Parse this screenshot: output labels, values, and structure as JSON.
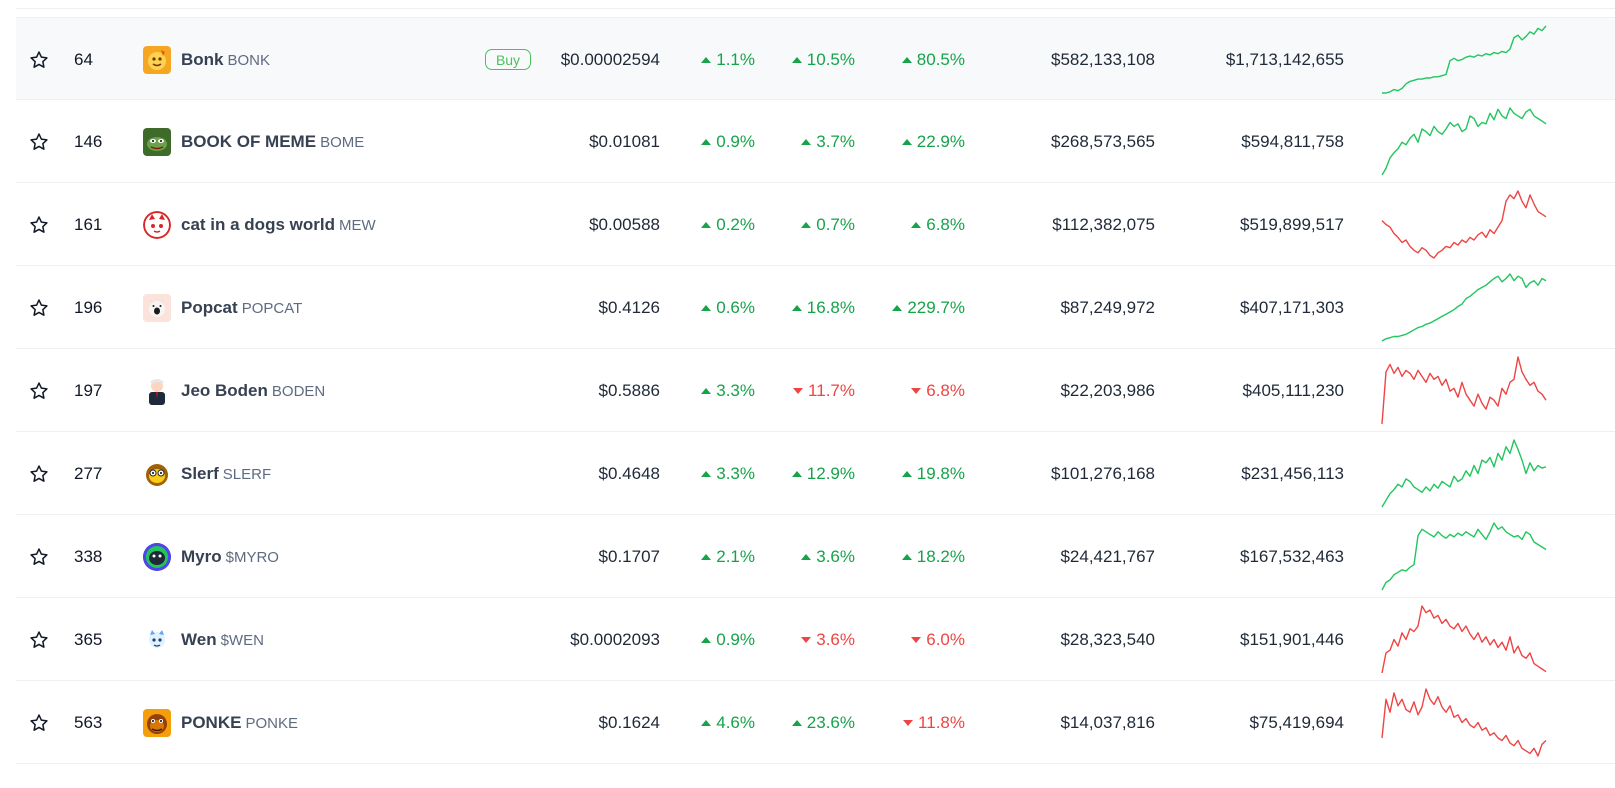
{
  "actions": {
    "buy_label": "Buy"
  },
  "colors": {
    "up": "#16a34a",
    "down": "#ef4444",
    "spark_up": "#22c55e",
    "spark_down": "#ef4444"
  },
  "rows": [
    {
      "rank": "64",
      "name": "Bonk",
      "symbol": "BONK",
      "logo": "bonk-logo",
      "price": "$0.00002594",
      "c1h": "1.1%",
      "c1h_dir": "up",
      "c24h": "10.5%",
      "c24h_dir": "up",
      "c7d": "80.5%",
      "c7d_dir": "up",
      "volume": "$582,133,108",
      "mcap": "$1,713,142,655",
      "trend": "up",
      "spark": [
        2,
        2,
        3,
        5,
        4,
        6,
        10,
        12,
        13,
        14,
        14,
        15,
        15,
        16,
        16,
        17,
        18,
        30,
        32,
        30,
        31,
        33,
        34,
        33,
        35,
        34,
        36,
        35,
        37,
        36,
        38,
        37,
        40,
        50,
        52,
        48,
        51,
        55,
        53,
        58,
        56,
        60
      ]
    },
    {
      "rank": "146",
      "name": "BOOK OF MEME",
      "symbol": "BOME",
      "logo": "bome-logo",
      "price": "$0.01081",
      "c1h": "0.9%",
      "c1h_dir": "up",
      "c24h": "3.7%",
      "c24h_dir": "up",
      "c7d": "22.9%",
      "c7d_dir": "up",
      "volume": "$268,573,565",
      "mcap": "$594,811,758",
      "trend": "up",
      "spark": [
        5,
        10,
        18,
        22,
        25,
        30,
        28,
        33,
        36,
        30,
        40,
        38,
        35,
        42,
        38,
        36,
        40,
        45,
        42,
        44,
        38,
        40,
        50,
        48,
        42,
        45,
        44,
        52,
        47,
        55,
        50,
        48,
        56,
        52,
        50,
        48,
        53,
        55,
        50,
        48,
        46,
        44
      ]
    },
    {
      "rank": "161",
      "name": "cat in a dogs world",
      "symbol": "MEW",
      "logo": "mew-logo",
      "price": "$0.00588",
      "c1h": "0.2%",
      "c1h_dir": "up",
      "c24h": "0.7%",
      "c24h_dir": "up",
      "c7d": "6.8%",
      "c7d_dir": "up",
      "volume": "$112,382,075",
      "mcap": "$519,899,517",
      "trend": "down",
      "spark": [
        35,
        32,
        30,
        25,
        22,
        18,
        20,
        15,
        12,
        10,
        14,
        12,
        8,
        6,
        10,
        12,
        15,
        14,
        18,
        16,
        20,
        18,
        22,
        20,
        24,
        26,
        22,
        28,
        25,
        30,
        35,
        50,
        55,
        52,
        58,
        50,
        45,
        55,
        48,
        42,
        40,
        38
      ]
    },
    {
      "rank": "196",
      "name": "Popcat",
      "symbol": "POPCAT",
      "logo": "popcat-logo",
      "price": "$0.4126",
      "c1h": "0.6%",
      "c1h_dir": "up",
      "c24h": "16.8%",
      "c24h_dir": "up",
      "c7d": "229.7%",
      "c7d_dir": "up",
      "volume": "$87,249,972",
      "mcap": "$407,171,303",
      "trend": "up",
      "spark": [
        2,
        4,
        5,
        6,
        6,
        7,
        8,
        10,
        12,
        14,
        15,
        17,
        18,
        20,
        22,
        24,
        26,
        28,
        30,
        33,
        35,
        40,
        42,
        45,
        48,
        50,
        52,
        55,
        58,
        60,
        55,
        58,
        62,
        56,
        60,
        58,
        50,
        54,
        56,
        52,
        58,
        56
      ]
    },
    {
      "rank": "197",
      "name": "Jeo Boden",
      "symbol": "BODEN",
      "logo": "boden-logo",
      "price": "$0.5886",
      "c1h": "3.3%",
      "c1h_dir": "up",
      "c24h": "11.7%",
      "c24h_dir": "down",
      "c7d": "6.8%",
      "c7d_dir": "down",
      "volume": "$22,203,986",
      "mcap": "$405,111,230",
      "trend": "down",
      "spark": [
        10,
        45,
        50,
        44,
        48,
        42,
        46,
        44,
        40,
        46,
        42,
        38,
        44,
        40,
        42,
        36,
        40,
        32,
        34,
        28,
        38,
        30,
        26,
        22,
        30,
        24,
        20,
        28,
        26,
        22,
        34,
        30,
        38,
        40,
        55,
        45,
        40,
        36,
        38,
        32,
        30,
        26
      ]
    },
    {
      "rank": "277",
      "name": "Slerf",
      "symbol": "SLERF",
      "logo": "slerf-logo",
      "price": "$0.4648",
      "c1h": "3.3%",
      "c1h_dir": "up",
      "c24h": "12.9%",
      "c24h_dir": "up",
      "c7d": "19.8%",
      "c7d_dir": "up",
      "volume": "$101,276,168",
      "mcap": "$231,456,113",
      "trend": "up",
      "spark": [
        5,
        10,
        15,
        18,
        22,
        20,
        26,
        24,
        20,
        18,
        16,
        20,
        17,
        22,
        19,
        24,
        22,
        20,
        28,
        24,
        26,
        32,
        28,
        36,
        30,
        40,
        38,
        42,
        35,
        45,
        40,
        50,
        45,
        55,
        48,
        40,
        30,
        38,
        32,
        36,
        34,
        35
      ]
    },
    {
      "rank": "338",
      "name": "Myro",
      "symbol": "$MYRO",
      "logo": "myro-logo",
      "price": "$0.1707",
      "c1h": "2.1%",
      "c1h_dir": "up",
      "c24h": "3.6%",
      "c24h_dir": "up",
      "c7d": "18.2%",
      "c7d_dir": "up",
      "volume": "$24,421,767",
      "mcap": "$167,532,463",
      "trend": "up",
      "spark": [
        2,
        8,
        10,
        14,
        16,
        18,
        17,
        20,
        22,
        45,
        50,
        48,
        46,
        44,
        48,
        45,
        43,
        46,
        44,
        47,
        45,
        48,
        46,
        44,
        50,
        46,
        42,
        48,
        55,
        50,
        52,
        48,
        46,
        44,
        45,
        42,
        48,
        46,
        40,
        38,
        36,
        34
      ]
    },
    {
      "rank": "365",
      "name": "Wen",
      "symbol": "$WEN",
      "logo": "wen-logo",
      "price": "$0.0002093",
      "c1h": "0.9%",
      "c1h_dir": "up",
      "c24h": "3.6%",
      "c24h_dir": "down",
      "c7d": "6.0%",
      "c7d_dir": "down",
      "volume": "$28,323,540",
      "mcap": "$151,901,446",
      "trend": "down",
      "spark": [
        5,
        20,
        22,
        30,
        25,
        35,
        30,
        38,
        36,
        40,
        55,
        50,
        52,
        46,
        48,
        42,
        45,
        40,
        38,
        42,
        36,
        40,
        34,
        30,
        35,
        28,
        32,
        26,
        30,
        24,
        28,
        22,
        32,
        20,
        25,
        18,
        16,
        20,
        12,
        10,
        8,
        6
      ]
    },
    {
      "rank": "563",
      "name": "PONKE",
      "symbol": "PONKE",
      "logo": "ponke-logo",
      "price": "$0.1624",
      "c1h": "4.6%",
      "c1h_dir": "up",
      "c24h": "23.6%",
      "c24h_dir": "up",
      "c7d": "11.8%",
      "c7d_dir": "down",
      "volume": "$14,037,816",
      "mcap": "$75,419,694",
      "trend": "down",
      "spark": [
        20,
        50,
        40,
        55,
        45,
        50,
        42,
        40,
        48,
        38,
        44,
        58,
        50,
        46,
        52,
        44,
        40,
        45,
        36,
        38,
        32,
        35,
        30,
        28,
        32,
        26,
        28,
        22,
        24,
        20,
        18,
        22,
        16,
        14,
        18,
        12,
        10,
        8,
        12,
        6,
        15,
        18
      ]
    }
  ]
}
